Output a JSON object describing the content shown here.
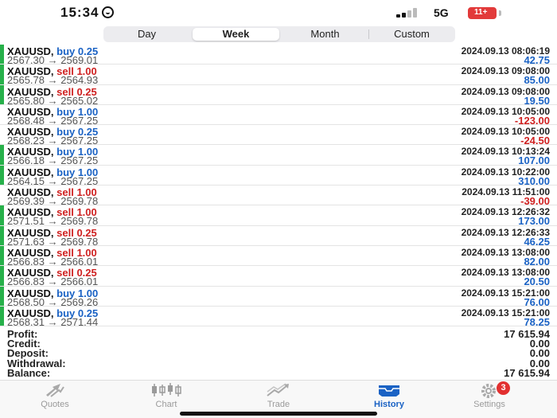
{
  "status_bar": {
    "time": "15:34",
    "network": "5G",
    "battery": "11+"
  },
  "period_tabs": [
    {
      "label": "Day",
      "active": false
    },
    {
      "label": "Week",
      "active": true
    },
    {
      "label": "Month",
      "active": false
    },
    {
      "label": "Custom",
      "active": false
    }
  ],
  "deals": [
    {
      "symbol": "XAUUSD,",
      "side": "buy",
      "volume": "0.25",
      "open": "2567.30",
      "close": "2569.01",
      "time": "2024.09.13 08:06:19",
      "profit": "42.75",
      "win": true
    },
    {
      "symbol": "XAUUSD,",
      "side": "sell",
      "volume": "1.00",
      "open": "2565.78",
      "close": "2564.93",
      "time": "2024.09.13 09:08:00",
      "profit": "85.00",
      "win": true
    },
    {
      "symbol": "XAUUSD,",
      "side": "sell",
      "volume": "0.25",
      "open": "2565.80",
      "close": "2565.02",
      "time": "2024.09.13 09:08:00",
      "profit": "19.50",
      "win": true
    },
    {
      "symbol": "XAUUSD,",
      "side": "buy",
      "volume": "1.00",
      "open": "2568.48",
      "close": "2567.25",
      "time": "2024.09.13 10:05:00",
      "profit": "-123.00",
      "win": false
    },
    {
      "symbol": "XAUUSD,",
      "side": "buy",
      "volume": "0.25",
      "open": "2568.23",
      "close": "2567.25",
      "time": "2024.09.13 10:05:00",
      "profit": "-24.50",
      "win": false
    },
    {
      "symbol": "XAUUSD,",
      "side": "buy",
      "volume": "1.00",
      "open": "2566.18",
      "close": "2567.25",
      "time": "2024.09.13 10:13:24",
      "profit": "107.00",
      "win": true
    },
    {
      "symbol": "XAUUSD,",
      "side": "buy",
      "volume": "1.00",
      "open": "2564.15",
      "close": "2567.25",
      "time": "2024.09.13 10:22:00",
      "profit": "310.00",
      "win": true
    },
    {
      "symbol": "XAUUSD,",
      "side": "sell",
      "volume": "1.00",
      "open": "2569.39",
      "close": "2569.78",
      "time": "2024.09.13 11:51:00",
      "profit": "-39.00",
      "win": false
    },
    {
      "symbol": "XAUUSD,",
      "side": "sell",
      "volume": "1.00",
      "open": "2571.51",
      "close": "2569.78",
      "time": "2024.09.13 12:26:32",
      "profit": "173.00",
      "win": true
    },
    {
      "symbol": "XAUUSD,",
      "side": "sell",
      "volume": "0.25",
      "open": "2571.63",
      "close": "2569.78",
      "time": "2024.09.13 12:26:33",
      "profit": "46.25",
      "win": true
    },
    {
      "symbol": "XAUUSD,",
      "side": "sell",
      "volume": "1.00",
      "open": "2566.83",
      "close": "2566.01",
      "time": "2024.09.13 13:08:00",
      "profit": "82.00",
      "win": true
    },
    {
      "symbol": "XAUUSD,",
      "side": "sell",
      "volume": "0.25",
      "open": "2566.83",
      "close": "2566.01",
      "time": "2024.09.13 13:08:00",
      "profit": "20.50",
      "win": true
    },
    {
      "symbol": "XAUUSD,",
      "side": "buy",
      "volume": "1.00",
      "open": "2568.50",
      "close": "2569.26",
      "time": "2024.09.13 15:21:00",
      "profit": "76.00",
      "win": true
    },
    {
      "symbol": "XAUUSD,",
      "side": "buy",
      "volume": "0.25",
      "open": "2568.31",
      "close": "2571.44",
      "time": "2024.09.13 15:21:00",
      "profit": "78.25",
      "win": true
    }
  ],
  "arrow": "→",
  "summary": [
    {
      "label": "Profit:",
      "value": "17 615.94"
    },
    {
      "label": "Credit:",
      "value": "0.00"
    },
    {
      "label": "Deposit:",
      "value": "0.00"
    },
    {
      "label": "Withdrawal:",
      "value": "0.00"
    },
    {
      "label": "Balance:",
      "value": "17 615.94"
    }
  ],
  "tab_bar": [
    {
      "label": "Quotes",
      "icon": "quotes-icon",
      "active": false
    },
    {
      "label": "Chart",
      "icon": "chart-icon",
      "active": false
    },
    {
      "label": "Trade",
      "icon": "trade-icon",
      "active": false
    },
    {
      "label": "History",
      "icon": "history-icon",
      "active": true
    },
    {
      "label": "Settings",
      "icon": "gear-icon",
      "active": false,
      "badge": "3"
    }
  ],
  "colors": {
    "buy": "#1a62c4",
    "sell": "#cf2020",
    "win_marker": "#27b04a",
    "active_tab": "#1a62c4"
  }
}
